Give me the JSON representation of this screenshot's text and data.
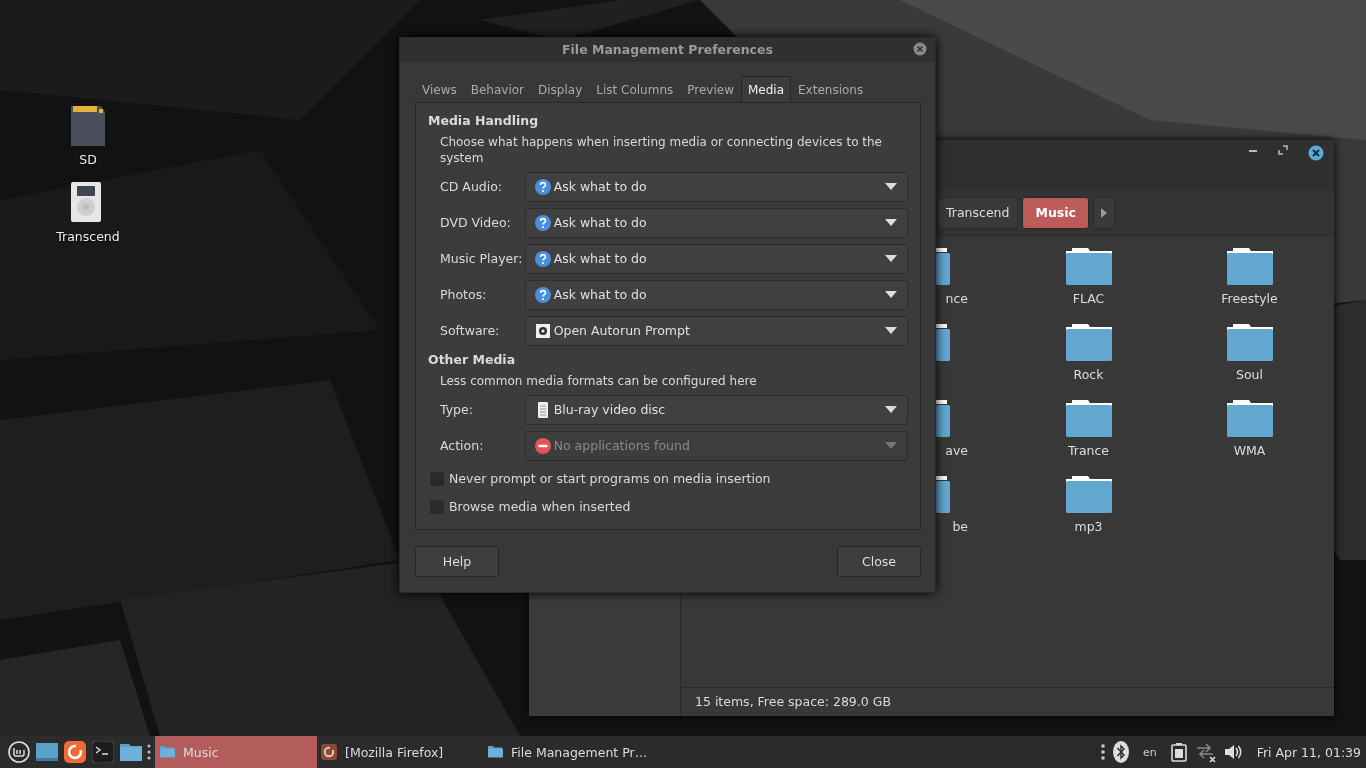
{
  "desktop_icons": [
    {
      "label": "SD",
      "kind": "sdcard"
    },
    {
      "label": "Transcend",
      "kind": "drive"
    }
  ],
  "file_manager": {
    "breadcrumbs": [
      {
        "label": "Transcend",
        "selected": false
      },
      {
        "label": "Music",
        "selected": true
      }
    ],
    "items": [
      {
        "kind": "cut",
        "label": "nce"
      },
      {
        "kind": "folder",
        "label": "FLAC"
      },
      {
        "kind": "folder",
        "label": "Freestyle"
      },
      {
        "kind": "cut_icon"
      },
      {
        "kind": "folder",
        "label": "Rock"
      },
      {
        "kind": "folder",
        "label": "Soul"
      },
      {
        "kind": "cut",
        "label": "ave"
      },
      {
        "kind": "folder",
        "label": "Trance"
      },
      {
        "kind": "folder",
        "label": "WMA"
      },
      {
        "kind": "cut",
        "label": "be"
      },
      {
        "kind": "folder",
        "label": "mp3"
      }
    ],
    "status_bar": "15 items, Free space: 289.0 GB"
  },
  "dialog": {
    "title": "File Management Preferences",
    "tabs": [
      {
        "label": "Views",
        "selected": false
      },
      {
        "label": "Behavior",
        "selected": false
      },
      {
        "label": "Display",
        "selected": false
      },
      {
        "label": "List Columns",
        "selected": false
      },
      {
        "label": "Preview",
        "selected": false
      },
      {
        "label": "Media",
        "selected": true
      },
      {
        "label": "Extensions",
        "selected": false
      }
    ],
    "sections": [
      {
        "heading": "Media Handling",
        "description": "Choose what happens when inserting media or connecting devices to the system",
        "rows": [
          {
            "label": "CD Audio:",
            "value": "Ask what to do",
            "kind": "question",
            "disabled": false
          },
          {
            "label": "DVD Video:",
            "value": "Ask what to do",
            "kind": "question",
            "disabled": false
          },
          {
            "label": "Music Player:",
            "value": "Ask what to do",
            "kind": "question",
            "disabled": false
          },
          {
            "label": "Photos:",
            "value": "Ask what to do",
            "kind": "question",
            "disabled": false
          },
          {
            "label": "Software:",
            "value": "Open Autorun Prompt",
            "kind": "gear",
            "disabled": false
          }
        ]
      },
      {
        "heading": "Other Media",
        "description": "Less common media formats can be configured here",
        "rows": [
          {
            "label": "Type:",
            "value": "Blu-ray video disc",
            "kind": "disc",
            "disabled": false
          },
          {
            "label": "Action:",
            "value": "No applications found",
            "kind": "none_found",
            "disabled": true
          }
        ]
      }
    ],
    "checkboxes": [
      {
        "label": "Never prompt or start programs on media insertion",
        "checked": false
      },
      {
        "label": "Browse media when inserted",
        "checked": false
      }
    ],
    "buttons": [
      "Help",
      "Close"
    ]
  },
  "taskbar": {
    "launchers": [
      {
        "kind": "menu"
      },
      {
        "kind": "desktop"
      },
      {
        "kind": "firefox"
      },
      {
        "kind": "terminal"
      },
      {
        "kind": "files"
      }
    ],
    "windows": [
      {
        "label": "Music",
        "kind": "folder",
        "selected": true
      },
      {
        "label": "[Mozilla Firefox]",
        "kind": "firefox",
        "selected": false
      },
      {
        "label": "File Management Pr…",
        "kind": "folder",
        "selected": false
      }
    ],
    "tray": [
      {
        "kind": "dots"
      },
      {
        "kind": "bluetooth"
      },
      {
        "kind": "lang",
        "label": "en"
      },
      {
        "kind": "battery"
      },
      {
        "kind": "network"
      },
      {
        "kind": "volume"
      }
    ],
    "clock": "Fri Apr 11, 01:39"
  }
}
